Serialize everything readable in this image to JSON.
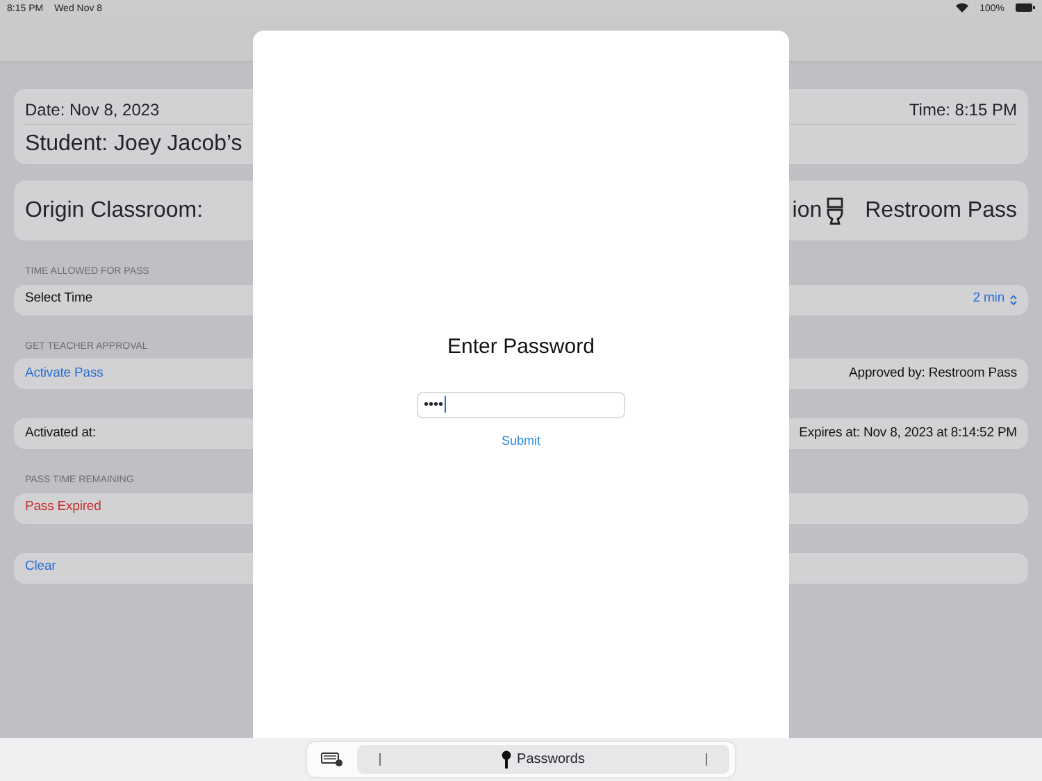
{
  "status_bar": {
    "time": "8:15 PM",
    "date": "Wed Nov 8",
    "battery": "100%"
  },
  "header_card": {
    "date": "Date: Nov 8, 2023",
    "time": "Time: 8:15 PM",
    "student": "Student: Joey Jacob’s"
  },
  "origin_card": {
    "label": "Origin Classroom:",
    "destination_fragment": "ion",
    "pass_type": "Restroom Pass"
  },
  "sections": [
    {
      "header": "TIME ALLOWED FOR PASS",
      "left": {
        "text": "Select Time",
        "kind": "plain"
      },
      "right": {
        "text": "2 min",
        "kind": "picker"
      }
    },
    {
      "header": "GET TEACHER APPROVAL",
      "left": {
        "text": "Activate Pass",
        "kind": "link"
      },
      "right": {
        "text": "Approved by: Restroom Pass",
        "kind": "plain"
      }
    },
    {
      "left": {
        "text": "Activated at:",
        "kind": "plain"
      },
      "right": {
        "text": "Expires at: Nov 8, 2023 at 8:14:52 PM",
        "kind": "plain"
      }
    },
    {
      "header": "PASS TIME REMAINING",
      "left": {
        "text": "Pass Expired",
        "kind": "alert"
      }
    },
    {
      "left": {
        "text": "Clear",
        "kind": "link"
      }
    }
  ],
  "modal": {
    "title": "Enter Password",
    "password_value": "••••",
    "submit": "Submit"
  },
  "keyboard_bar": {
    "passwords": "Passwords"
  }
}
